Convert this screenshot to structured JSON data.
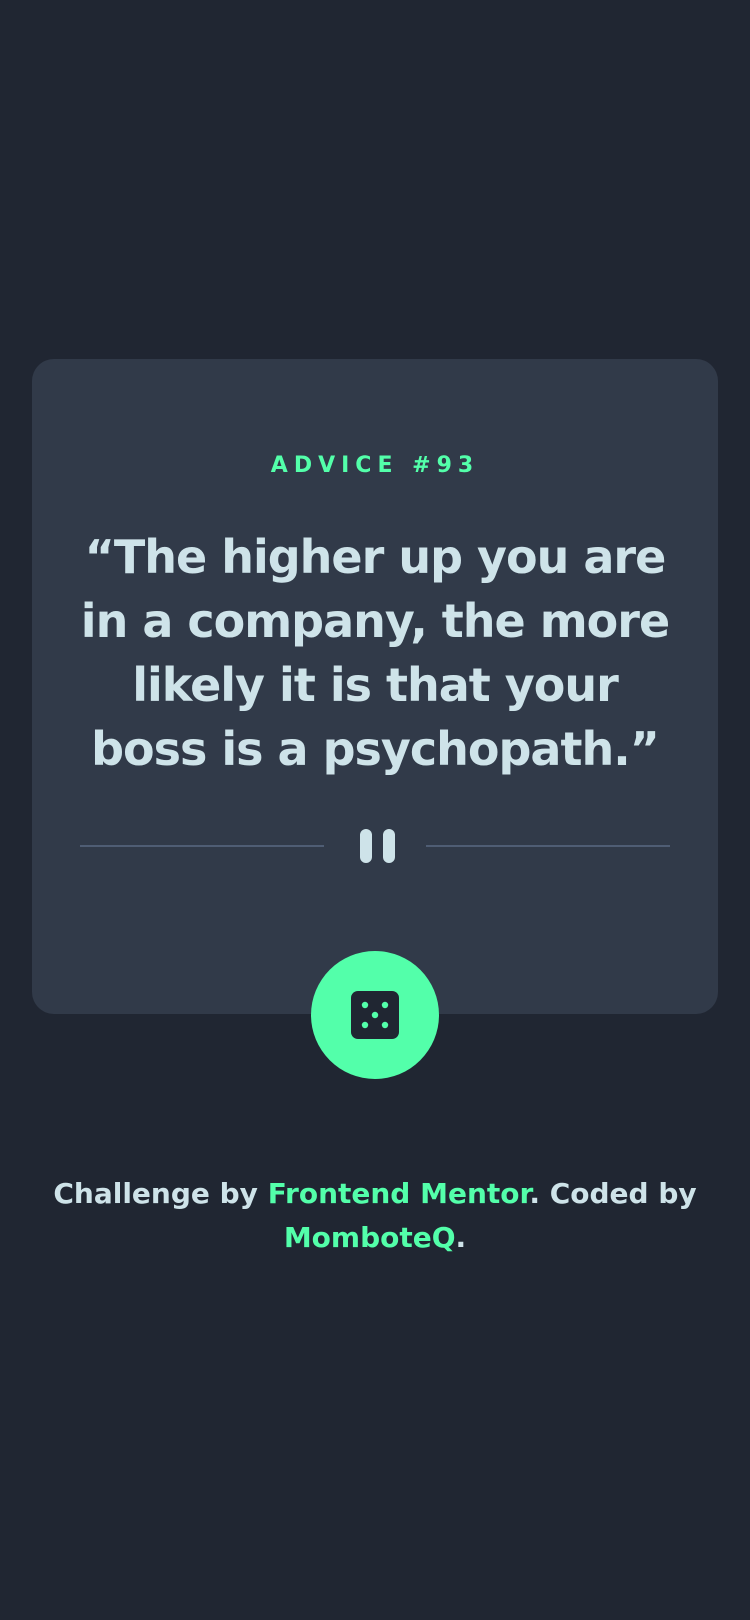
{
  "card": {
    "advice_prefix": "ADVICE #",
    "advice_number": "93",
    "quote": "“The higher up you are in a company, the more likely it is that your boss is a psychopath.”"
  },
  "dice_button": {
    "icon": "dice-icon",
    "background_color": "#53FFAA"
  },
  "footer": {
    "text_challenge": "Challenge by ",
    "link_frontend_mentor": "Frontend Mentor",
    "text_coded_by": ". Coded by ",
    "link_author": "MomboteQ",
    "text_end": "."
  },
  "colors": {
    "background": "#202632",
    "card": "#313A49",
    "accent": "#53FFAA",
    "text": "#CEE3E9",
    "divider": "#4F5D74"
  }
}
